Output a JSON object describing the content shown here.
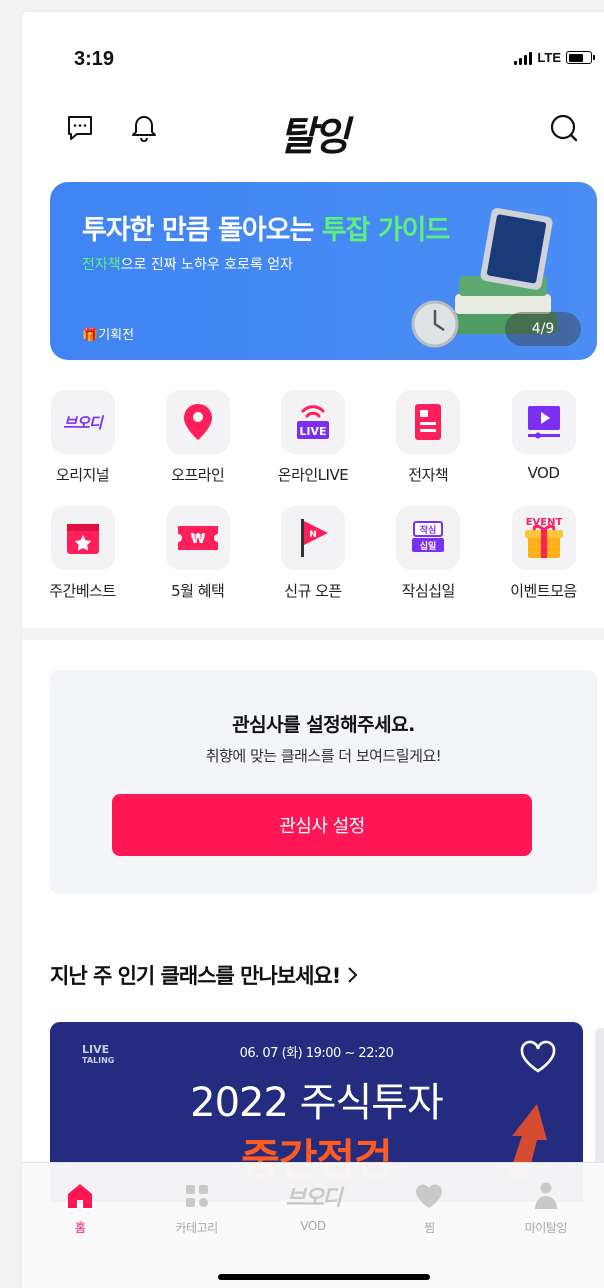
{
  "status": {
    "time": "3:19",
    "network": "LTE"
  },
  "header": {
    "logo": "탈잉"
  },
  "banner": {
    "title_pre": "투자한 만큼 돌아오는 ",
    "title_accent": "투잡 가이드",
    "sub_accent": "전자책",
    "sub_rest": "으로 진짜 노하우 호로록 얻자",
    "tag": "기획전",
    "pager": "4/9",
    "accent_color": "#5df07f",
    "bg_color": "#4189f3"
  },
  "categories": [
    {
      "label": "오리지널",
      "icon": "original-logo-icon"
    },
    {
      "label": "오프라인",
      "icon": "location-pin-icon"
    },
    {
      "label": "온라인LIVE",
      "icon": "live-broadcast-icon"
    },
    {
      "label": "전자책",
      "icon": "ebook-icon"
    },
    {
      "label": "VOD",
      "icon": "vod-play-icon"
    },
    {
      "label": "주간베스트",
      "icon": "weekly-best-calendar-icon"
    },
    {
      "label": "5월 혜택",
      "icon": "coupon-ticket-icon"
    },
    {
      "label": "신규 오픈",
      "icon": "new-flag-icon"
    },
    {
      "label": "작심십일",
      "icon": "resolution-badge-icon"
    },
    {
      "label": "이벤트모음",
      "icon": "event-gift-icon"
    }
  ],
  "category_icon_text": {
    "original": "브오디",
    "live": "LIVE",
    "resolution_top": "작심",
    "resolution_bottom": "십일",
    "event": "EVENT"
  },
  "interest": {
    "heading": "관심사를 설정해주세요.",
    "desc": "취향에 맞는 클래스를 더 보여드릴게요!",
    "button": "관심사 설정",
    "button_color": "#ff1655"
  },
  "section": {
    "title": "지난 주 인기 클래스를 만나보세요!",
    "chevron": "chevron-right-icon"
  },
  "live_card": {
    "badge_top": "LIVE",
    "badge_bottom": "TALING",
    "date": "06. 07 (화) 19:00 ~ 22:20",
    "title": "2022 주식투자",
    "highlight": "중간점검"
  },
  "tabbar": {
    "items": [
      {
        "label": "홈",
        "icon": "home-icon",
        "active": true
      },
      {
        "label": "카테고리",
        "icon": "category-grid-icon",
        "active": false
      },
      {
        "label": "VOD",
        "icon": "vod-logo-icon",
        "active": false,
        "logo_text": "브오디"
      },
      {
        "label": "찜",
        "icon": "heart-icon",
        "active": false
      },
      {
        "label": "마이탈잉",
        "icon": "profile-icon",
        "active": false
      }
    ],
    "active_color": "#ff1655"
  }
}
